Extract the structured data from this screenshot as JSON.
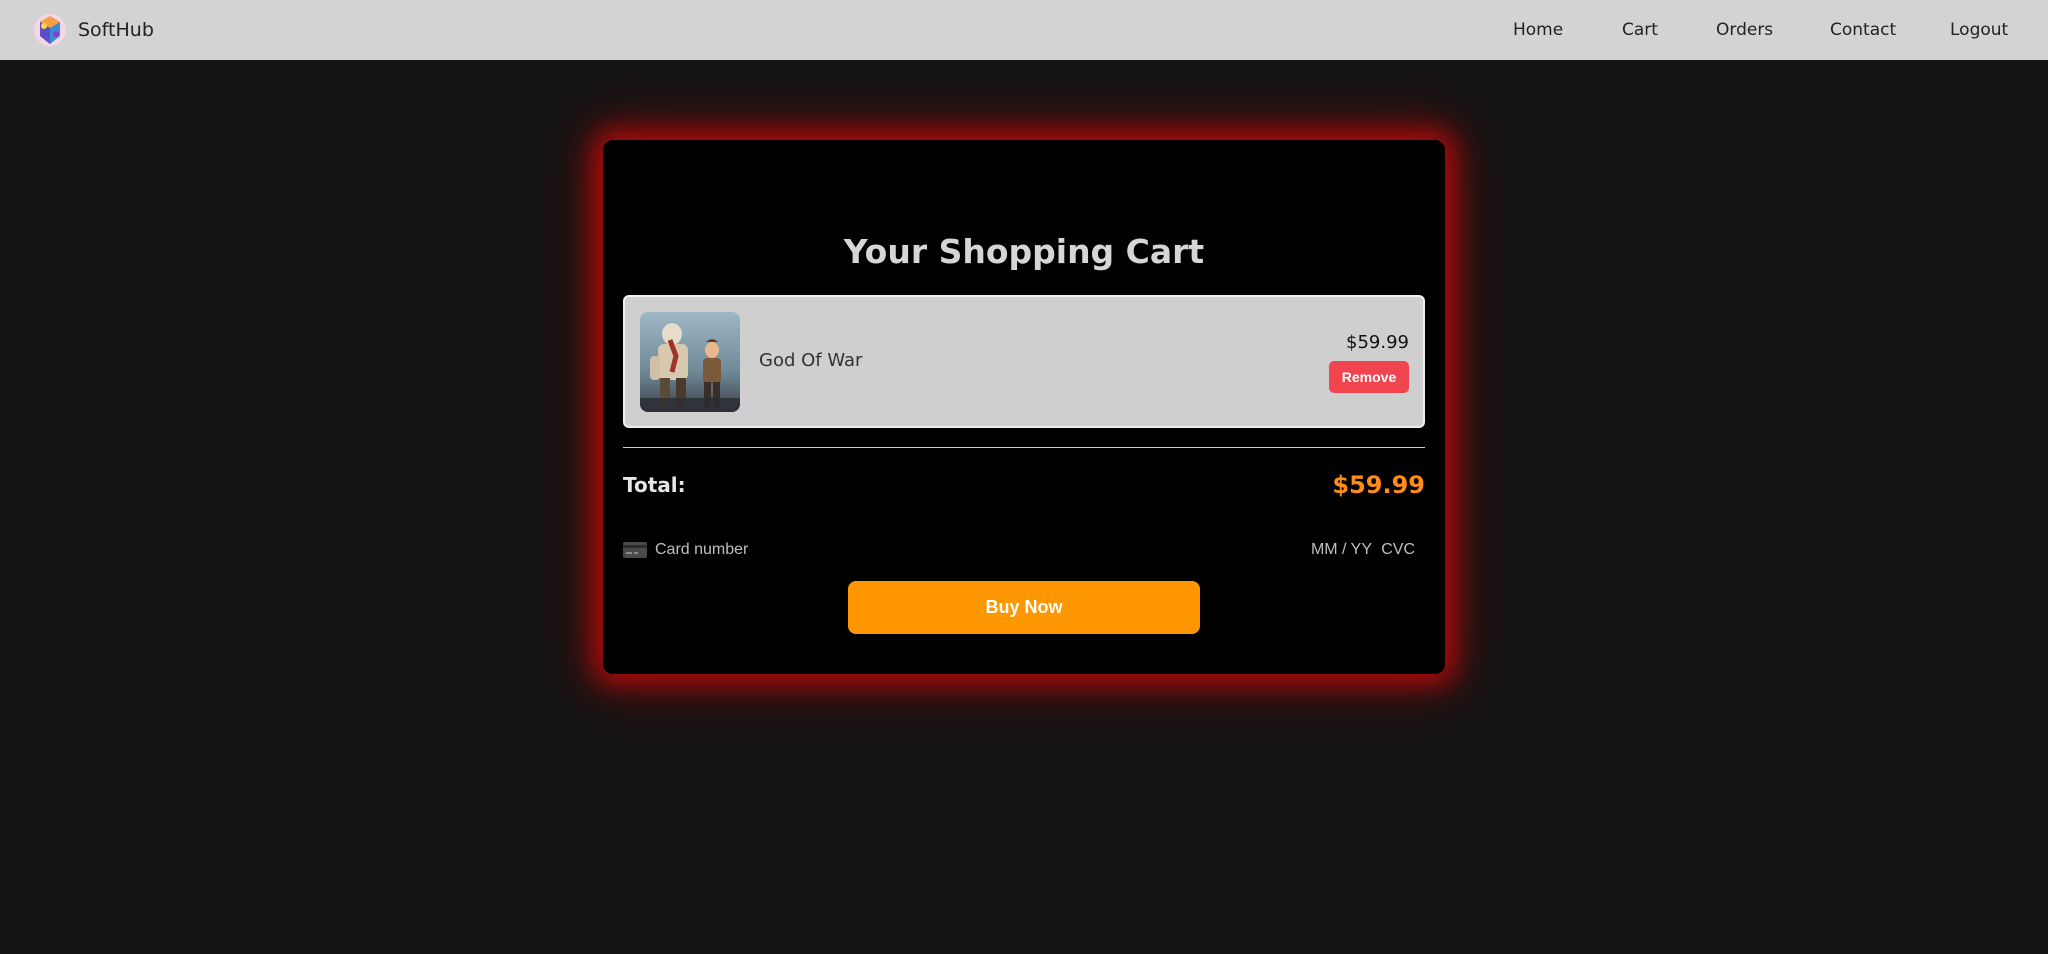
{
  "nav": {
    "brand": "SoftHub",
    "links": [
      {
        "label": "Home"
      },
      {
        "label": "Cart"
      },
      {
        "label": "Orders"
      },
      {
        "label": "Contact"
      },
      {
        "label": "Logout"
      }
    ]
  },
  "cart": {
    "title": "Your Shopping Cart",
    "items": [
      {
        "name": "God Of War",
        "price": "$59.99",
        "remove_label": "Remove",
        "image_icon": "game-cover-image"
      }
    ],
    "total_label": "Total:",
    "total_value": "$59.99"
  },
  "payment": {
    "card_icon": "credit-card-icon",
    "card_number_placeholder": "Card number",
    "expiry_placeholder": "MM / YY",
    "cvc_placeholder": "CVC",
    "buy_label": "Buy Now"
  },
  "colors": {
    "accent": "#ff9800",
    "total": "#ff8c1a",
    "remove": "#f0444e",
    "glow": "#c80a0a",
    "navbar": "#d3d3d3",
    "background": "#141414"
  }
}
